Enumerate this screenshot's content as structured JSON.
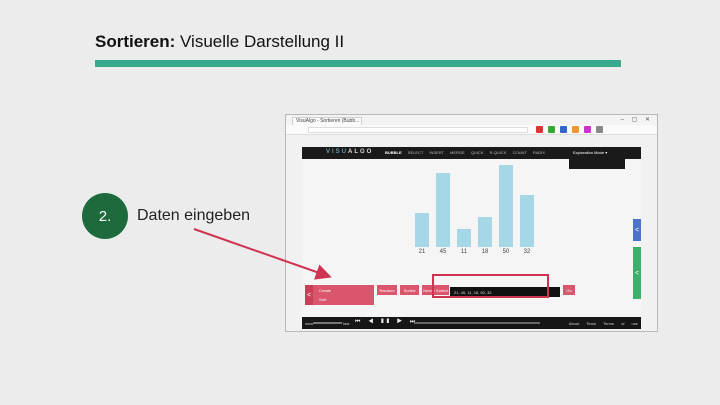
{
  "slide": {
    "title_bold": "Sortieren:",
    "title_rest": " Visuelle Darstellung II",
    "step_number": "2.",
    "step_text": "Daten eingeben"
  },
  "browser": {
    "tab_title": "VisuAlgo - Sortieren (Bubb...",
    "window_buttons": "– ▢ ✕"
  },
  "visualgo": {
    "logo_prefix": "VISU",
    "logo_suffix": "ALGO",
    "nav_algorithms": [
      "BUBBLE",
      "SELECT",
      "INSERT",
      "MERGE",
      "QUICK",
      "R-QUICK",
      "COUNT",
      "RADIX"
    ],
    "active_algorithm": "BUBBLE",
    "mode_label": "Exploration Mode ▾",
    "bars": [
      21,
      45,
      11,
      18,
      50,
      32
    ],
    "ymax": 50,
    "left_panel_lines": [
      "Create",
      "Sort"
    ],
    "options": [
      "Random",
      "Sorted",
      "Nearly Sorted"
    ],
    "input_value": "21, 45, 11, 18, 50, 32",
    "go_label": "Go",
    "side_arrow": "<",
    "footer": {
      "slow": "slow",
      "fast": "fast",
      "controls": "⏮ ◀ ❚❚ ▶ ⏭",
      "links": "About Team Terms of use"
    },
    "colors": {
      "bar": "#a6d7e6",
      "accent_pink": "#d9566d",
      "tab_blue": "#4b73c9",
      "tab_green": "#3db16b"
    }
  }
}
